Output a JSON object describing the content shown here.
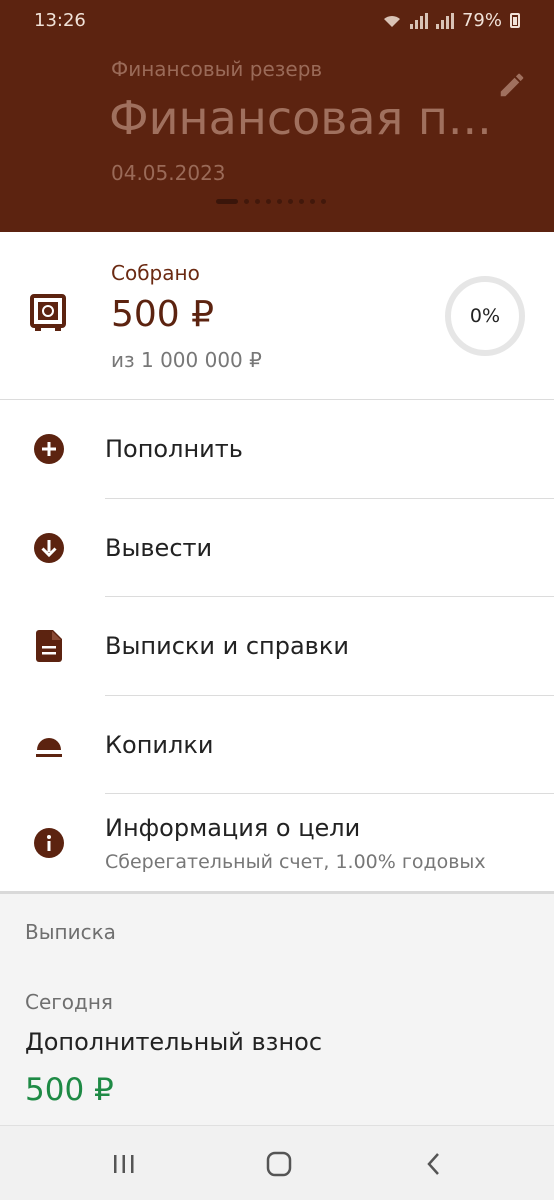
{
  "status_bar": {
    "time": "13:26",
    "battery": "79%"
  },
  "header": {
    "subtitle": "Финансовый резерв",
    "title": "Финансовая п...",
    "date": "04.05.2023"
  },
  "summary": {
    "label": "Собрано",
    "amount": "500 ₽",
    "goal": "из 1 000 000 ₽",
    "progress_percent": "0%"
  },
  "menu": {
    "items": [
      {
        "label": "Пополнить",
        "icon": "plus-circle-icon"
      },
      {
        "label": "Вывести",
        "icon": "arrow-down-circle-icon"
      },
      {
        "label": "Выписки и справки",
        "icon": "document-icon"
      },
      {
        "label": "Копилки",
        "icon": "piggy-dome-icon"
      },
      {
        "label": "Информация о цели",
        "sublabel": "Сберегательный счет, 1.00% годовых",
        "icon": "info-circle-icon"
      }
    ]
  },
  "statement": {
    "section_title": "Выписка",
    "day": "Сегодня",
    "tx_name": "Дополнительный взнос",
    "tx_amount": "500 ₽"
  },
  "colors": {
    "brand": "#5c2310",
    "positive_amount": "#1e8a45"
  }
}
